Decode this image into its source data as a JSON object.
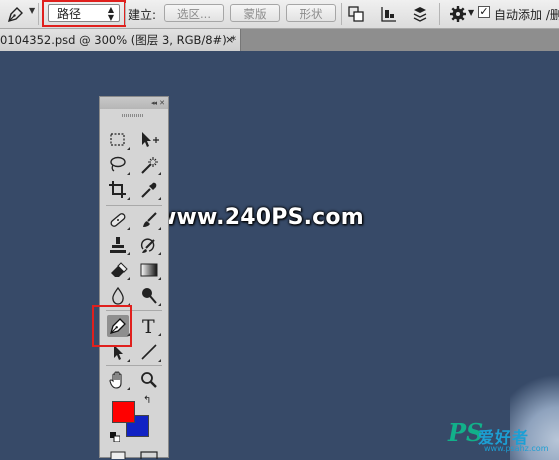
{
  "options_bar": {
    "tool_icon": "pen-tool-icon",
    "mode_value": "路径",
    "make_label": "建立:",
    "selection_button": "选区...",
    "mask_button": "蒙版",
    "shape_button": "形状",
    "auto_add_delete_label": "自动添加 /删",
    "auto_add_delete_checked": true
  },
  "document_tab": {
    "title": "0104352.psd @ 300% (图层 3, RGB/8#) *",
    "close_glyph": "×"
  },
  "canvas": {
    "watermark": "www.240PS.com",
    "logo_ps": "PS",
    "logo_cn": "爱好者",
    "logo_url": "www.psahz.com",
    "background_color": "#374a68"
  },
  "tools_panel": {
    "collapse_glyph": "◂◂",
    "close_glyph": "✕",
    "foreground_color": "#ff0000",
    "background_color": "#1122c4",
    "type_tool_glyph": "T",
    "swap_glyph": "↰",
    "active_tool": "pen-tool"
  },
  "highlight_color": "#e0201d"
}
